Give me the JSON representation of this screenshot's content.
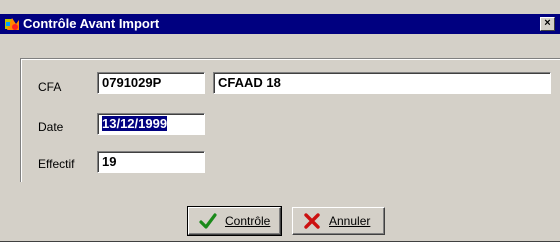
{
  "window": {
    "title": "Contrôle Avant Import",
    "close_label": "×"
  },
  "form": {
    "cfa_label": "CFA",
    "cfa_code": "0791029P",
    "cfa_name": "CFAAD 18",
    "date_label": "Date",
    "date_value": "13/12/1999",
    "effectif_label": "Effectif",
    "effectif_value": "19"
  },
  "buttons": {
    "controle_label": "Contrôle",
    "annuler_label": "Annuler"
  },
  "icons": {
    "controle": "check-icon",
    "annuler": "cross-icon",
    "app": "app-icon"
  },
  "colors": {
    "titlebar": "#000080",
    "window_bg": "#d4d0c8",
    "check": "#1a8a1a",
    "cross": "#cc1111",
    "selection": "#000080"
  }
}
